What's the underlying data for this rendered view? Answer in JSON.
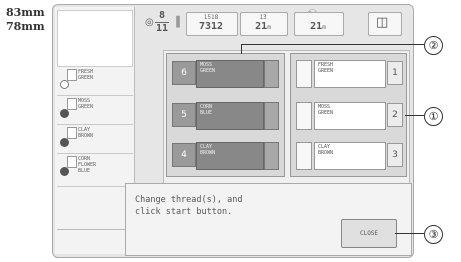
{
  "dimensions": {
    "width": "83mm",
    "height": "78mm"
  },
  "top_bar": {
    "needle_fraction_top": "8",
    "needle_fraction_bottom": "11",
    "stitches_top": "1518",
    "stitches_bottom": "7312",
    "time_top": "13",
    "time_bottom": "21",
    "time_unit": "m",
    "total_time": "21",
    "total_unit": "m"
  },
  "thread_list": [
    {
      "line1": "FRESH",
      "line2": "GREEN"
    },
    {
      "line1": "MOSS",
      "line2": "GREEN"
    },
    {
      "line1": "CLAY",
      "line2": "BROWN"
    },
    {
      "line1": "CORN",
      "line2": "FLOWER",
      "line3": "BLUE"
    }
  ],
  "current_spools": [
    {
      "number": "6",
      "line1": "MOSS",
      "line2": "GREEN"
    },
    {
      "number": "5",
      "line1": "CORN",
      "line2": "BLUE"
    },
    {
      "number": "4",
      "line1": "CLAY",
      "line2": "BROWN"
    }
  ],
  "new_spools": [
    {
      "number": "1",
      "line1": "FRESH",
      "line2": "GREEN"
    },
    {
      "number": "2",
      "line1": "MOSS",
      "line2": "GREEN"
    },
    {
      "number": "3",
      "line1": "CLAY",
      "line2": "BROWN"
    }
  ],
  "message": "Change thread(s), and\nclick start button.",
  "close_button": "CLOSE",
  "callouts": {
    "c1": "①",
    "c2": "②",
    "c3": "③"
  }
}
